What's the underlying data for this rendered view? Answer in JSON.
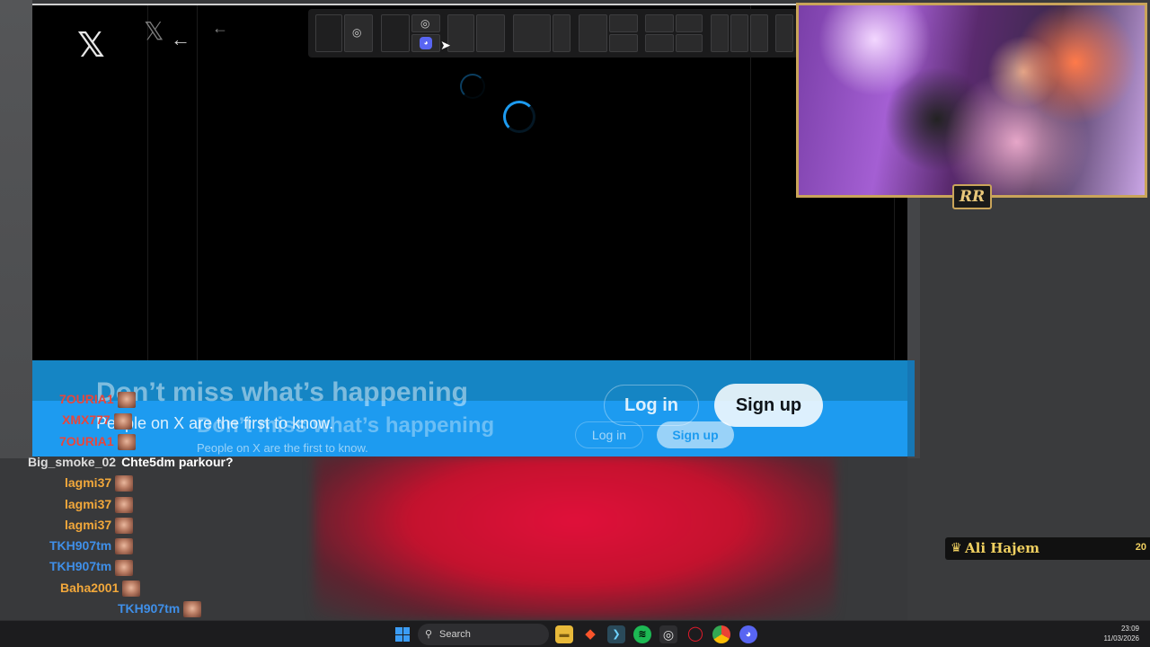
{
  "x_window": {
    "logo": "𝕏",
    "logo_ghost": "𝕏",
    "back_arrow": "←",
    "back_arrow_ghost": "←"
  },
  "banner": {
    "headline": "Don’t miss what’s happening",
    "subtext": "People on X are the first to know.",
    "headline_ghost": "Don’t miss what’s happening",
    "subtext_ghost": "People on X are the first to know.",
    "login_label": "Log in",
    "signup_label": "Sign up",
    "login_label_ghost": "Log in",
    "signup_label_ghost": "Sign up"
  },
  "colors": {
    "x_blue": "#1d9bf0",
    "webcam_frame": "#c9a45a",
    "alert_gold": "#f0d060"
  },
  "webcam": {
    "logo_text": "RR"
  },
  "chat": [
    {
      "user": "7OURIA1",
      "color": "#e8463c",
      "message": ""
    },
    {
      "user": "XMX777",
      "color": "#e8463c",
      "message": ""
    },
    {
      "user": "7OURIA1",
      "color": "#e8463c",
      "message": ""
    },
    {
      "user": "Big_smoke_02",
      "color": "#dcdcdc",
      "message": "Chte5dm parkour?"
    },
    {
      "user": "lagmi37",
      "color": "#f2a83b",
      "message": ""
    },
    {
      "user": "lagmi37",
      "color": "#f2a83b",
      "message": ""
    },
    {
      "user": "lagmi37",
      "color": "#f2a83b",
      "message": ""
    },
    {
      "user": "TKH907tm",
      "color": "#3f8fe8",
      "message": ""
    },
    {
      "user": "TKH907tm",
      "color": "#3f8fe8",
      "message": ""
    },
    {
      "user": "Baha2001",
      "color": "#f2a83b",
      "message": ""
    },
    {
      "user": "TKH907tm",
      "color": "#3f8fe8",
      "message": ""
    }
  ],
  "alert": {
    "name": "Ali Hajem",
    "value": "20",
    "icon": "trophy-icon"
  },
  "taskbar": {
    "search_placeholder": "Search",
    "time": "23:09",
    "date": "11/03/2026"
  }
}
